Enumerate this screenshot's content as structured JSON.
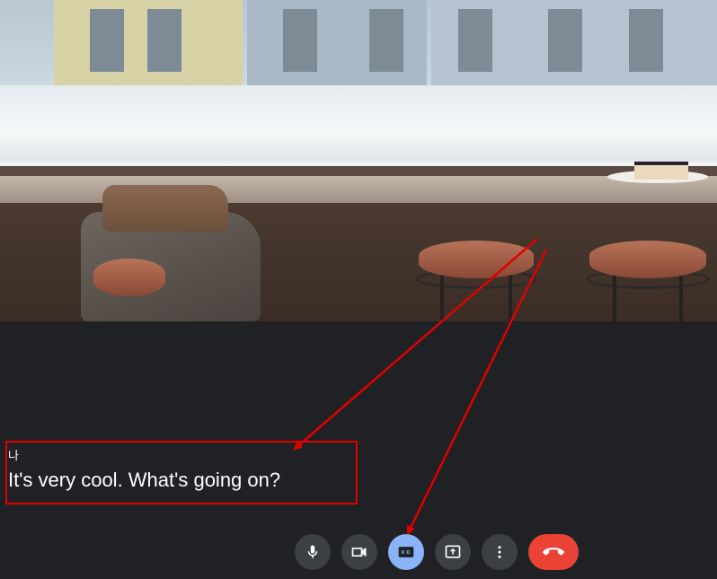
{
  "caption": {
    "speaker": "나",
    "text": "It's very cool. What's going on?"
  },
  "controls": {
    "mic_icon": "microphone-icon",
    "camera_icon": "video-camera-icon",
    "captions_icon": "closed-captions-icon",
    "captions_active": true,
    "present_icon": "present-screen-icon",
    "more_icon": "more-vert-icon",
    "hangup_icon": "call-end-icon"
  },
  "colors": {
    "background": "#202124",
    "control_button": "#3c4043",
    "captions_active": "#8ab4f8",
    "hangup": "#ea4335",
    "annotation": "#e00000"
  }
}
